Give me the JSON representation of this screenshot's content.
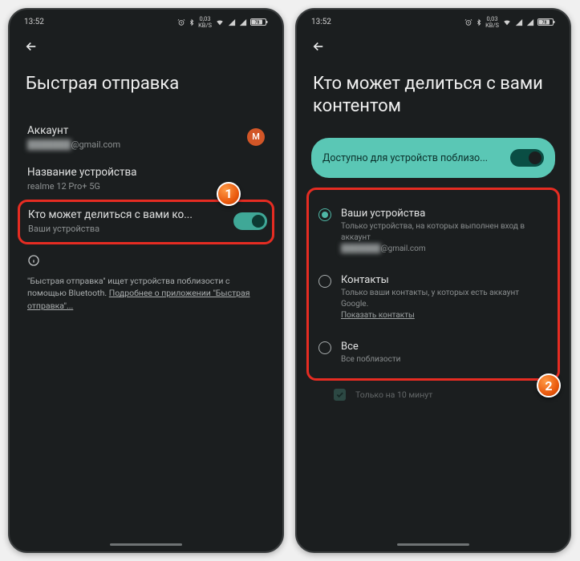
{
  "status": {
    "time": "13:52",
    "net": "0,03",
    "unit": "KB/S",
    "battery": "78"
  },
  "left": {
    "title": "Быстрая отправка",
    "account": {
      "label": "Аккаунт",
      "email": "@gmail.com",
      "avatar": "M"
    },
    "device": {
      "label": "Название устройства",
      "value": "realme 12 Pro+ 5G"
    },
    "share": {
      "label": "Кто может делиться с вами ко...",
      "sub": "Ваши устройства"
    },
    "info": {
      "text": "\"Быстрая отправка\" ищет устройства поблизости с помощью Bluetooth. ",
      "link": "Подробнее о приложении \"Быстрая отправка\"..."
    },
    "badge": "1"
  },
  "right": {
    "title": "Кто может делиться с вами контентом",
    "chip": "Доступно для устройств поблизо...",
    "opt1": {
      "label": "Ваши устройства",
      "sub1": "Только устройства, на которых выполнен вход в аккаунт",
      "sub2": "@gmail.com"
    },
    "opt2": {
      "label": "Контакты",
      "sub": "Только ваши контакты, у которых есть аккаунт Google.",
      "link": "Показать контакты"
    },
    "opt3": {
      "label": "Все",
      "sub": "Все поблизости"
    },
    "check": "Только на 10 минут",
    "badge": "2"
  }
}
